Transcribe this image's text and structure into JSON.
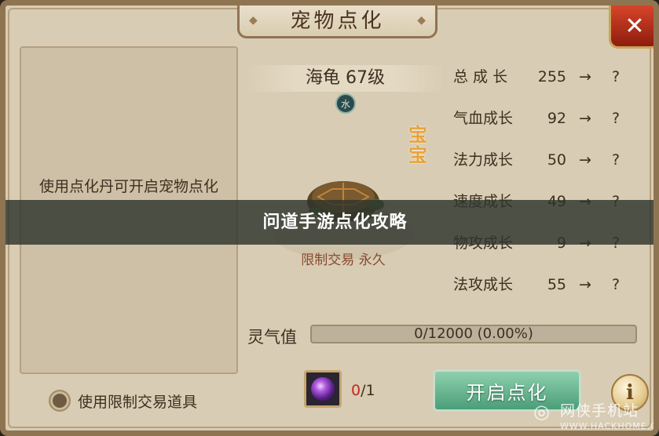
{
  "window": {
    "title": "宠物点化",
    "close_icon": "close-x-icon"
  },
  "left_panel": {
    "hint": "使用点化丹可开启宠物点化"
  },
  "restricted_option": {
    "label": "使用限制交易道具"
  },
  "pet": {
    "name_level": "海龟 67级",
    "element_glyph": "水",
    "baby_tag": "宝宝",
    "trade_status": "限制交易 永久"
  },
  "stats": [
    {
      "label": "总 成 长",
      "value": "255",
      "arrow": "→",
      "target": "?"
    },
    {
      "label": "气血成长",
      "value": "92",
      "arrow": "→",
      "target": "?"
    },
    {
      "label": "法力成长",
      "value": "50",
      "arrow": "→",
      "target": "?"
    },
    {
      "label": "速度成长",
      "value": "49",
      "arrow": "→",
      "target": "?"
    },
    {
      "label": "物攻成长",
      "value": "9",
      "arrow": "→",
      "target": "?"
    },
    {
      "label": "法攻成长",
      "value": "55",
      "arrow": "→",
      "target": "?"
    }
  ],
  "aura": {
    "label": "灵气值",
    "progress_text": "0/12000 (0.00%)",
    "fraction": 0
  },
  "item": {
    "icon": "purple-orb-icon",
    "count_current": "0",
    "count_total": "/1"
  },
  "buttons": {
    "start": "开启点化",
    "info": "i"
  },
  "banner": {
    "text": "问道手游点化攻略"
  },
  "watermark": {
    "title": "网侠手机站",
    "url": "WWW.HACKHOME.COM"
  },
  "colors": {
    "accent_red": "#c2281c",
    "button_green": "#4a9e78",
    "gold": "#e8a236"
  }
}
